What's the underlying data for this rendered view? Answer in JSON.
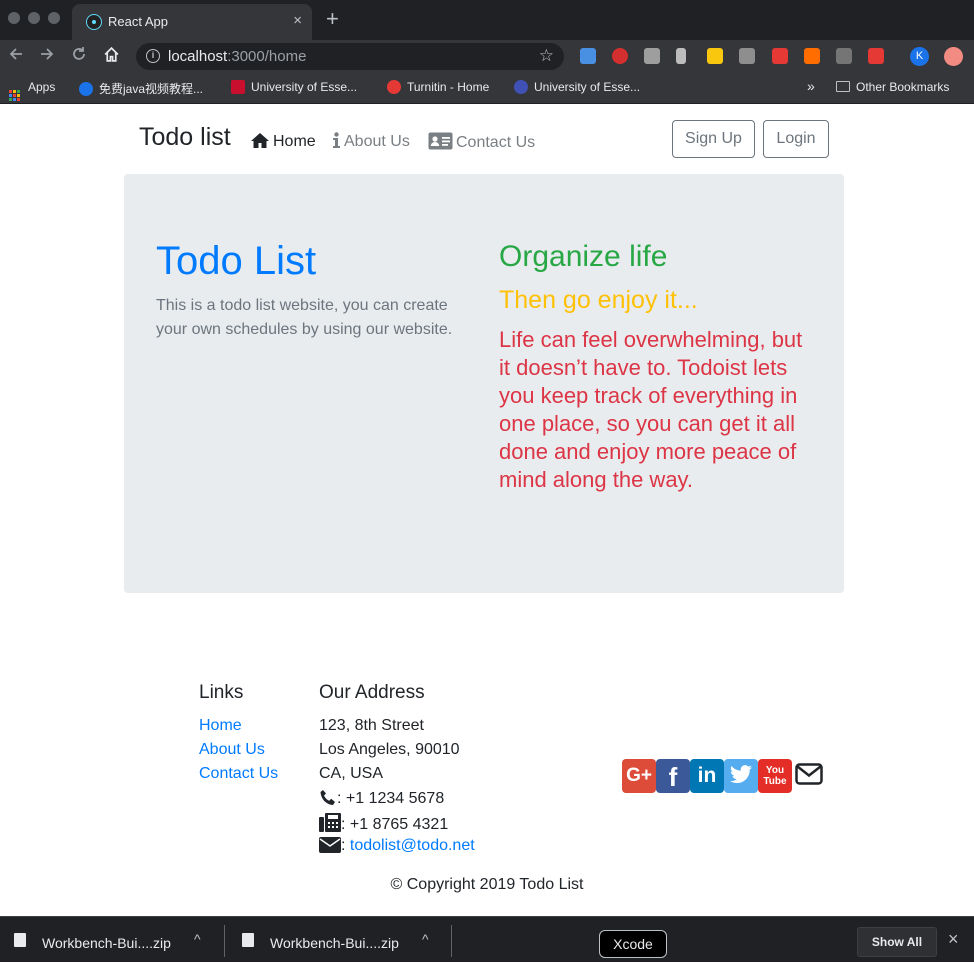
{
  "browser": {
    "tab_title": "React App",
    "tab_close": "×",
    "new_tab": "+",
    "url_host": "localhost",
    "url_path": ":3000/home",
    "avatar_letter": "K",
    "icons": [
      "back-icon",
      "forward-icon",
      "reload-icon",
      "home-icon",
      "info-icon",
      "star-icon"
    ],
    "bookmarks": [
      {
        "label": "Apps",
        "icon": "apps-grid-icon"
      },
      {
        "label": "免费java视频教程...",
        "icon": "bookmark-favicon",
        "color": "#1a73e8"
      },
      {
        "label": "University of Esse...",
        "icon": "bookmark-favicon",
        "color": "#c8102e"
      },
      {
        "label": "Turnitin - Home",
        "icon": "bookmark-favicon",
        "color": "#e53935"
      },
      {
        "label": "University of Esse...",
        "icon": "bookmark-favicon",
        "color": "#3f51b5"
      }
    ],
    "more_bookmarks": "»",
    "other_bookmarks": "Other Bookmarks"
  },
  "navbar": {
    "brand": "Todo list",
    "links": [
      "Home",
      "About Us",
      "Contact Us"
    ],
    "signup": "Sign Up",
    "login": "Login"
  },
  "jumbotron": {
    "title": "Todo List",
    "lead": "This is a todo list website, you can create your own schedules by using our website.",
    "h2": "Organize life",
    "h3": "Then go enjoy it...",
    "p": "Life can feel overwhelming, but it doesn’t have to. Todoist lets you keep track of everything in one place, so you can get it all done and enjoy more peace of mind along the way."
  },
  "footer": {
    "links_heading": "Links",
    "links": [
      "Home",
      "About Us",
      "Contact Us"
    ],
    "address_heading": "Our Address",
    "address": [
      "123, 8th Street",
      "Los Angeles, 90010",
      "CA, USA"
    ],
    "phone": ": +1 1234 5678",
    "fax": ": +1 8765 4321",
    "email_prefix": ":",
    "email": "todolist@todo.net",
    "social": [
      {
        "name": "google-plus",
        "glyph": "G+",
        "color": "#dd4b39"
      },
      {
        "name": "facebook",
        "glyph": "f",
        "color": "#3b5998"
      },
      {
        "name": "linkedin",
        "glyph": "in",
        "color": "#0077b5"
      },
      {
        "name": "twitter",
        "glyph": "t",
        "color": "#55acee"
      },
      {
        "name": "youtube",
        "glyph": "You Tube",
        "color": "#e52d27"
      }
    ],
    "copyright": "© Copyright 2019 Todo List"
  },
  "downloads": {
    "items": [
      "Workbench-Bui....zip",
      "Workbench-Bui....zip"
    ],
    "chevron": "^",
    "tooltip": "Xcode",
    "show_all": "Show All",
    "close": "×"
  },
  "colors": {
    "primary": "#007bff",
    "success": "#28a745",
    "warning": "#ffc107",
    "danger": "#dc3545",
    "jumbotron_bg": "#e9ecef"
  }
}
